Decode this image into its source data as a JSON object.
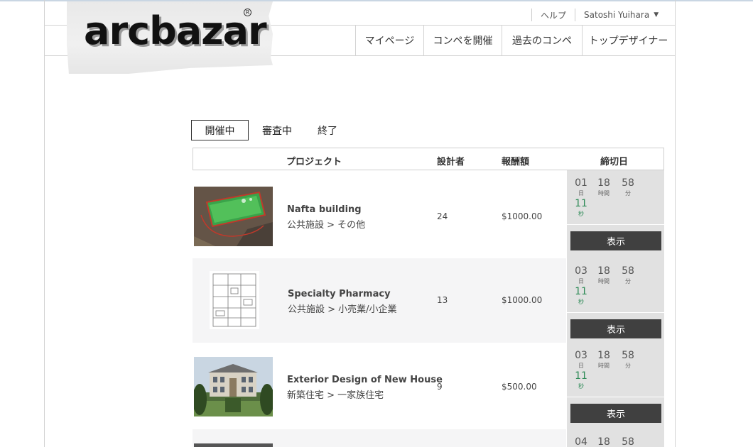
{
  "brand": {
    "logo_text": "arcbazar",
    "reg_mark": "R"
  },
  "utility": {
    "help": "ヘルプ",
    "user": "Satoshi Yuihara",
    "caret": "▼"
  },
  "nav": {
    "mypage": "マイページ",
    "host": "コンペを開催",
    "past": "過去のコンペ",
    "top_designers": "トップデザイナー"
  },
  "tabs": {
    "open": "開催中",
    "judging": "審査中",
    "closed": "終了"
  },
  "table": {
    "headers": {
      "project": "プロジェクト",
      "designers": "設計者",
      "reward": "報酬額",
      "deadline": "締切日"
    },
    "units": {
      "day": "日",
      "hour": "時間",
      "minute": "分",
      "second": "秒"
    },
    "view_label": "表示",
    "rows": [
      {
        "title": "Nafta building",
        "category": "公共施設 > その他",
        "designers": "24",
        "reward": "$1000.00",
        "days": "01",
        "hours": "18",
        "minutes": "58",
        "seconds": "11"
      },
      {
        "title": "Specialty Pharmacy",
        "category": "公共施設 > 小売業/小企業",
        "designers": "13",
        "reward": "$1000.00",
        "days": "03",
        "hours": "18",
        "minutes": "58",
        "seconds": "11"
      },
      {
        "title": "Exterior Design of New House",
        "category": "新築住宅 > 一家族住宅",
        "designers": "9",
        "reward": "$500.00",
        "days": "03",
        "hours": "18",
        "minutes": "58",
        "seconds": "11"
      },
      {
        "days": "04",
        "hours": "18",
        "minutes": "58"
      }
    ]
  },
  "colors": {
    "accent_seconds": "#2e8b57",
    "button": "#404040",
    "deadline_bg": "#e1e1e1"
  }
}
